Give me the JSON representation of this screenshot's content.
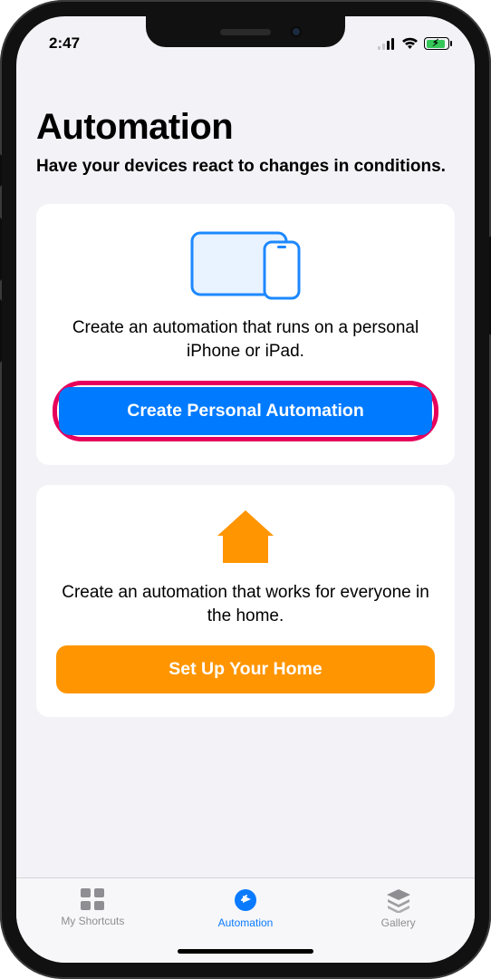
{
  "status": {
    "time": "2:47"
  },
  "header": {
    "title": "Automation",
    "subtitle": "Have your devices react to changes in conditions."
  },
  "cards": {
    "personal": {
      "description": "Create an automation that runs on a personal iPhone or iPad.",
      "button_label": "Create Personal Automation"
    },
    "home": {
      "description": "Create an automation that works for everyone in the home.",
      "button_label": "Set Up Your Home"
    }
  },
  "tabs": {
    "shortcuts": "My Shortcuts",
    "automation": "Automation",
    "gallery": "Gallery"
  }
}
